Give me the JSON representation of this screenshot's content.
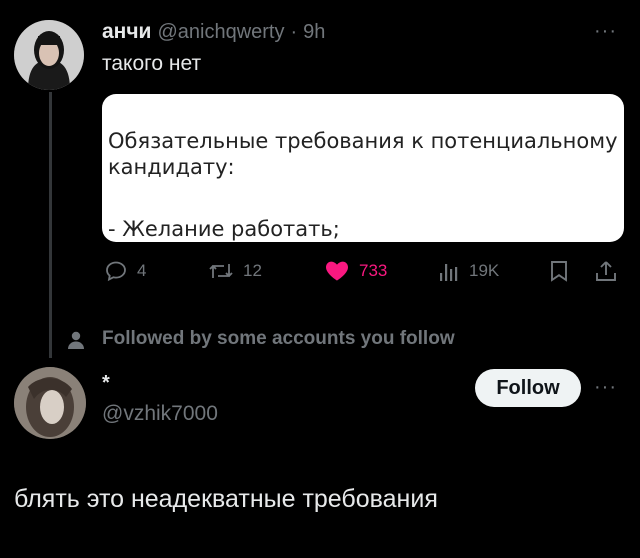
{
  "tweet": {
    "display_name": "анчи",
    "handle": "@anichqwerty",
    "separator": "·",
    "time": "9h",
    "more": "···",
    "text": "такого нет",
    "image_lines": [
      "Обязательные требования к потенциальному",
      "кандидату:",
      "- Желание работать;"
    ],
    "actions": {
      "replies": "4",
      "reposts": "12",
      "likes": "733",
      "views": "19K"
    },
    "like_color": "#f91880"
  },
  "followed_by": "Followed by some accounts you follow",
  "user_card": {
    "display_name": "*",
    "handle": "@vzhik7000",
    "follow_label": "Follow",
    "more": "···"
  },
  "reply_text": "блять это неадекватные требования"
}
